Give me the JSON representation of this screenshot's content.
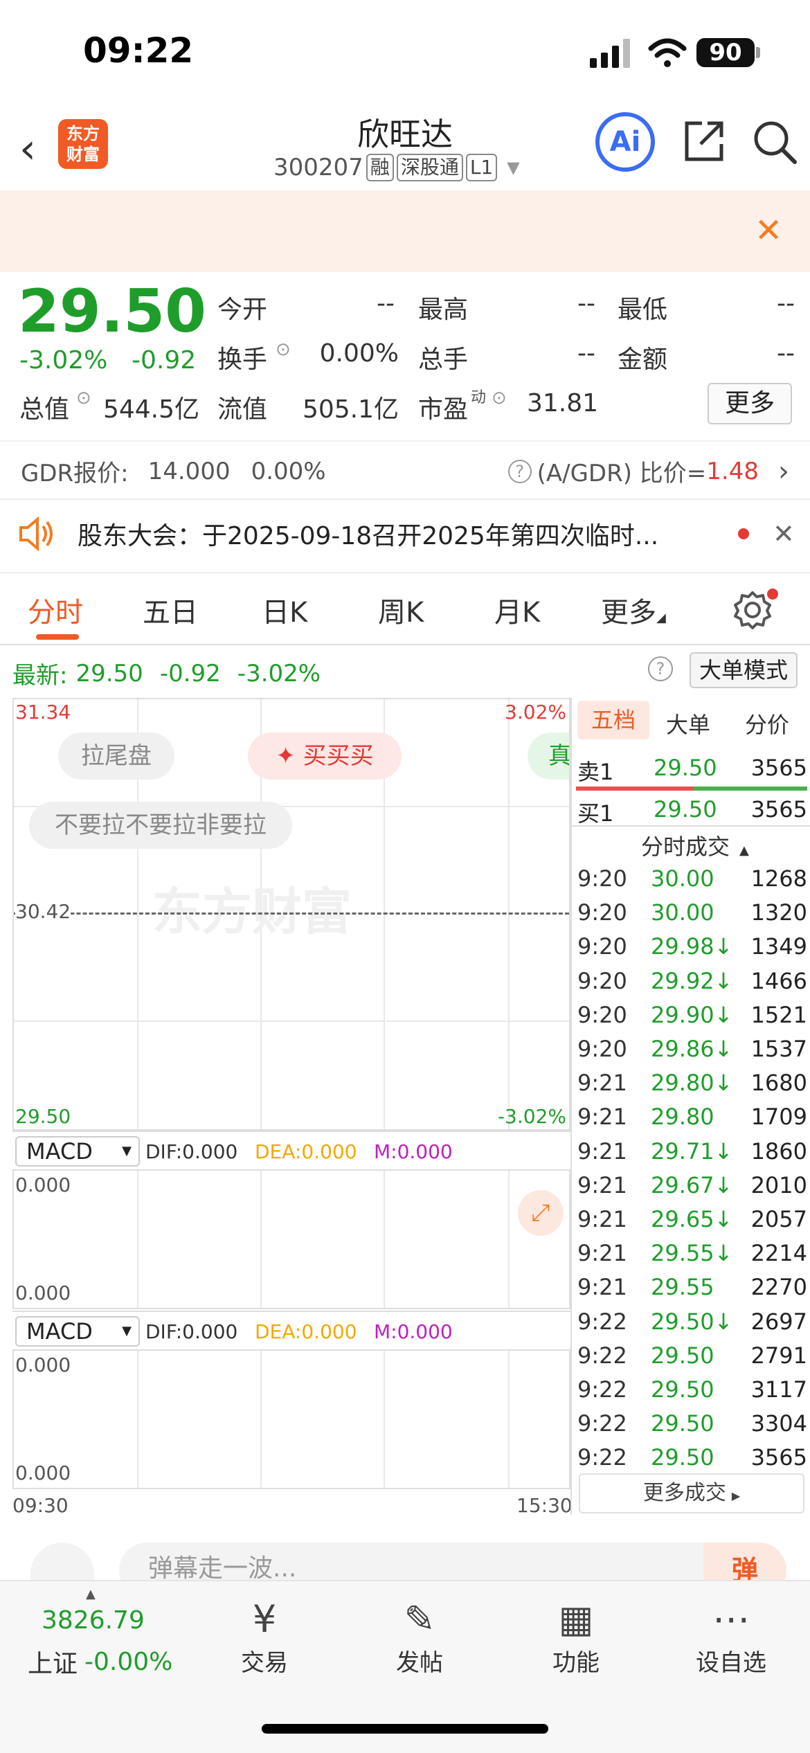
{
  "status_bar": {
    "time": "09:22",
    "battery": "90"
  },
  "header": {
    "title": "欣旺达",
    "code": "300207",
    "tags": [
      "融",
      "深股通",
      "L1"
    ],
    "logo_text": "东方\n财富",
    "ai_label": "Ai"
  },
  "quote": {
    "price": "29.50",
    "change_pct": "-3.02%",
    "change": "-0.92",
    "fields": [
      {
        "label": "今开",
        "value": "--"
      },
      {
        "label": "最高",
        "value": "--"
      },
      {
        "label": "最低",
        "value": "--"
      },
      {
        "label": "换手",
        "value": "0.00%"
      },
      {
        "label": "总手",
        "value": "--"
      },
      {
        "label": "金额",
        "value": "--"
      },
      {
        "label": "总值",
        "value": "544.5亿"
      },
      {
        "label": "流值",
        "value": "505.1亿"
      },
      {
        "label": "市盈",
        "value": "31.81"
      }
    ],
    "pe_superscript": "动",
    "more_label": "更多"
  },
  "gdr": {
    "label": "GDR报价:",
    "price": "14.000",
    "pct": "0.00%",
    "ratio_label": "(A/GDR) 比价=",
    "ratio_value": "1.48"
  },
  "notice": {
    "text": "股东大会：于2025-09-18召开2025年第四次临时..."
  },
  "tabs": [
    "分时",
    "五日",
    "日K",
    "周K",
    "月K",
    "更多"
  ],
  "latest": {
    "label": "最新:",
    "price": "29.50",
    "change": "-0.92",
    "pct": "-3.02%",
    "big_order_label": "大单模式"
  },
  "chart": {
    "y_max": "31.34",
    "y_max_pct": "3.02%",
    "y_mid": "30.42",
    "y_min": "29.50",
    "y_min_pct": "-3.02%",
    "x_start": "09:30",
    "x_end": "15:30",
    "watermark": "东方财富",
    "pills": {
      "tail": "拉尾盘",
      "buy": "买买买",
      "true": "真",
      "dont": "不要拉不要拉非要拉"
    }
  },
  "macd": [
    {
      "selector": "MACD",
      "dif": "DIF:0.000",
      "dea": "DEA:0.000",
      "m": "M:0.000",
      "top": "0.000",
      "bottom": "0.000"
    },
    {
      "selector": "MACD",
      "dif": "DIF:0.000",
      "dea": "DEA:0.000",
      "m": "M:0.000",
      "top": "0.000",
      "bottom": "0.000"
    }
  ],
  "order_book": {
    "tabs": [
      "五档",
      "大单",
      "分价"
    ],
    "sell1": {
      "label": "卖1",
      "price": "29.50",
      "vol": "3565"
    },
    "buy1": {
      "label": "买1",
      "price": "29.50",
      "vol": "3565"
    },
    "ticks_title": "分时成交",
    "ticks": [
      {
        "time": "9:20",
        "price": "30.00",
        "vol": "1268"
      },
      {
        "time": "9:20",
        "price": "30.00",
        "vol": "1320"
      },
      {
        "time": "9:20",
        "price": "29.98↓",
        "vol": "1349"
      },
      {
        "time": "9:20",
        "price": "29.92↓",
        "vol": "1466"
      },
      {
        "time": "9:20",
        "price": "29.90↓",
        "vol": "1521"
      },
      {
        "time": "9:20",
        "price": "29.86↓",
        "vol": "1537"
      },
      {
        "time": "9:21",
        "price": "29.80↓",
        "vol": "1680"
      },
      {
        "time": "9:21",
        "price": "29.80",
        "vol": "1709"
      },
      {
        "time": "9:21",
        "price": "29.71↓",
        "vol": "1860"
      },
      {
        "time": "9:21",
        "price": "29.67↓",
        "vol": "2010"
      },
      {
        "time": "9:21",
        "price": "29.65↓",
        "vol": "2057"
      },
      {
        "time": "9:21",
        "price": "29.55↓",
        "vol": "2214"
      },
      {
        "time": "9:21",
        "price": "29.55",
        "vol": "2270"
      },
      {
        "time": "9:22",
        "price": "29.50↓",
        "vol": "2697"
      },
      {
        "time": "9:22",
        "price": "29.50",
        "vol": "2791"
      },
      {
        "time": "9:22",
        "price": "29.50",
        "vol": "3117"
      },
      {
        "time": "9:22",
        "price": "29.50",
        "vol": "3304"
      },
      {
        "time": "9:22",
        "price": "29.50",
        "vol": "3565"
      }
    ],
    "more_label": "更多成交"
  },
  "comment": {
    "placeholder": "弹幕走一波...",
    "danmu_btn": "弹"
  },
  "bottom_nav": {
    "index_value": "3826.79",
    "index_name": "上证",
    "index_pct": "-0.00%",
    "items": [
      {
        "label": "交易",
        "icon": "trade-icon"
      },
      {
        "label": "发帖",
        "icon": "post-icon"
      },
      {
        "label": "功能",
        "icon": "apps-icon"
      },
      {
        "label": "设自选",
        "icon": "watchlist-icon"
      }
    ]
  }
}
